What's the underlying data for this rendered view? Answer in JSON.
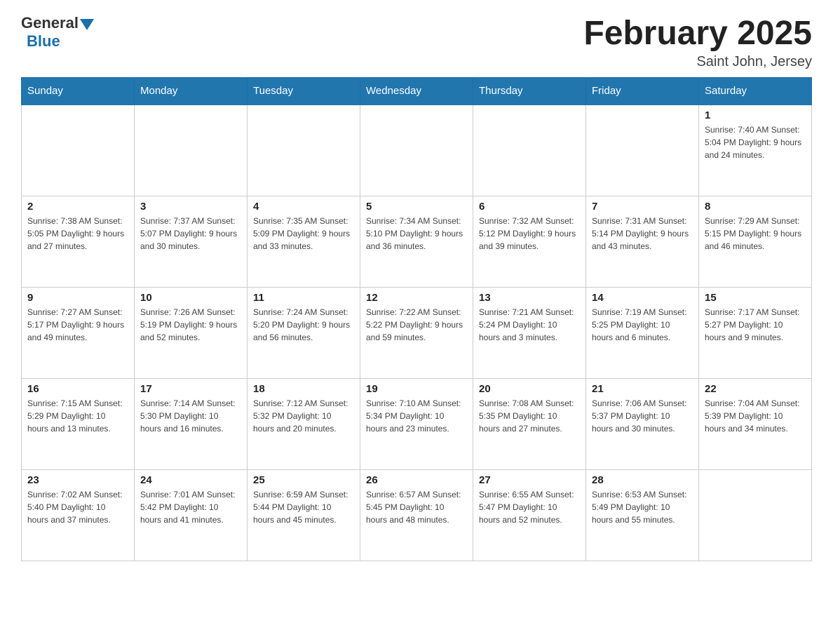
{
  "header": {
    "logo_general": "General",
    "logo_blue": "Blue",
    "month_title": "February 2025",
    "location": "Saint John, Jersey"
  },
  "weekdays": [
    "Sunday",
    "Monday",
    "Tuesday",
    "Wednesday",
    "Thursday",
    "Friday",
    "Saturday"
  ],
  "weeks": [
    [
      {
        "day": "",
        "info": ""
      },
      {
        "day": "",
        "info": ""
      },
      {
        "day": "",
        "info": ""
      },
      {
        "day": "",
        "info": ""
      },
      {
        "day": "",
        "info": ""
      },
      {
        "day": "",
        "info": ""
      },
      {
        "day": "1",
        "info": "Sunrise: 7:40 AM\nSunset: 5:04 PM\nDaylight: 9 hours and 24 minutes."
      }
    ],
    [
      {
        "day": "2",
        "info": "Sunrise: 7:38 AM\nSunset: 5:05 PM\nDaylight: 9 hours and 27 minutes."
      },
      {
        "day": "3",
        "info": "Sunrise: 7:37 AM\nSunset: 5:07 PM\nDaylight: 9 hours and 30 minutes."
      },
      {
        "day": "4",
        "info": "Sunrise: 7:35 AM\nSunset: 5:09 PM\nDaylight: 9 hours and 33 minutes."
      },
      {
        "day": "5",
        "info": "Sunrise: 7:34 AM\nSunset: 5:10 PM\nDaylight: 9 hours and 36 minutes."
      },
      {
        "day": "6",
        "info": "Sunrise: 7:32 AM\nSunset: 5:12 PM\nDaylight: 9 hours and 39 minutes."
      },
      {
        "day": "7",
        "info": "Sunrise: 7:31 AM\nSunset: 5:14 PM\nDaylight: 9 hours and 43 minutes."
      },
      {
        "day": "8",
        "info": "Sunrise: 7:29 AM\nSunset: 5:15 PM\nDaylight: 9 hours and 46 minutes."
      }
    ],
    [
      {
        "day": "9",
        "info": "Sunrise: 7:27 AM\nSunset: 5:17 PM\nDaylight: 9 hours and 49 minutes."
      },
      {
        "day": "10",
        "info": "Sunrise: 7:26 AM\nSunset: 5:19 PM\nDaylight: 9 hours and 52 minutes."
      },
      {
        "day": "11",
        "info": "Sunrise: 7:24 AM\nSunset: 5:20 PM\nDaylight: 9 hours and 56 minutes."
      },
      {
        "day": "12",
        "info": "Sunrise: 7:22 AM\nSunset: 5:22 PM\nDaylight: 9 hours and 59 minutes."
      },
      {
        "day": "13",
        "info": "Sunrise: 7:21 AM\nSunset: 5:24 PM\nDaylight: 10 hours and 3 minutes."
      },
      {
        "day": "14",
        "info": "Sunrise: 7:19 AM\nSunset: 5:25 PM\nDaylight: 10 hours and 6 minutes."
      },
      {
        "day": "15",
        "info": "Sunrise: 7:17 AM\nSunset: 5:27 PM\nDaylight: 10 hours and 9 minutes."
      }
    ],
    [
      {
        "day": "16",
        "info": "Sunrise: 7:15 AM\nSunset: 5:29 PM\nDaylight: 10 hours and 13 minutes."
      },
      {
        "day": "17",
        "info": "Sunrise: 7:14 AM\nSunset: 5:30 PM\nDaylight: 10 hours and 16 minutes."
      },
      {
        "day": "18",
        "info": "Sunrise: 7:12 AM\nSunset: 5:32 PM\nDaylight: 10 hours and 20 minutes."
      },
      {
        "day": "19",
        "info": "Sunrise: 7:10 AM\nSunset: 5:34 PM\nDaylight: 10 hours and 23 minutes."
      },
      {
        "day": "20",
        "info": "Sunrise: 7:08 AM\nSunset: 5:35 PM\nDaylight: 10 hours and 27 minutes."
      },
      {
        "day": "21",
        "info": "Sunrise: 7:06 AM\nSunset: 5:37 PM\nDaylight: 10 hours and 30 minutes."
      },
      {
        "day": "22",
        "info": "Sunrise: 7:04 AM\nSunset: 5:39 PM\nDaylight: 10 hours and 34 minutes."
      }
    ],
    [
      {
        "day": "23",
        "info": "Sunrise: 7:02 AM\nSunset: 5:40 PM\nDaylight: 10 hours and 37 minutes."
      },
      {
        "day": "24",
        "info": "Sunrise: 7:01 AM\nSunset: 5:42 PM\nDaylight: 10 hours and 41 minutes."
      },
      {
        "day": "25",
        "info": "Sunrise: 6:59 AM\nSunset: 5:44 PM\nDaylight: 10 hours and 45 minutes."
      },
      {
        "day": "26",
        "info": "Sunrise: 6:57 AM\nSunset: 5:45 PM\nDaylight: 10 hours and 48 minutes."
      },
      {
        "day": "27",
        "info": "Sunrise: 6:55 AM\nSunset: 5:47 PM\nDaylight: 10 hours and 52 minutes."
      },
      {
        "day": "28",
        "info": "Sunrise: 6:53 AM\nSunset: 5:49 PM\nDaylight: 10 hours and 55 minutes."
      },
      {
        "day": "",
        "info": ""
      }
    ]
  ]
}
